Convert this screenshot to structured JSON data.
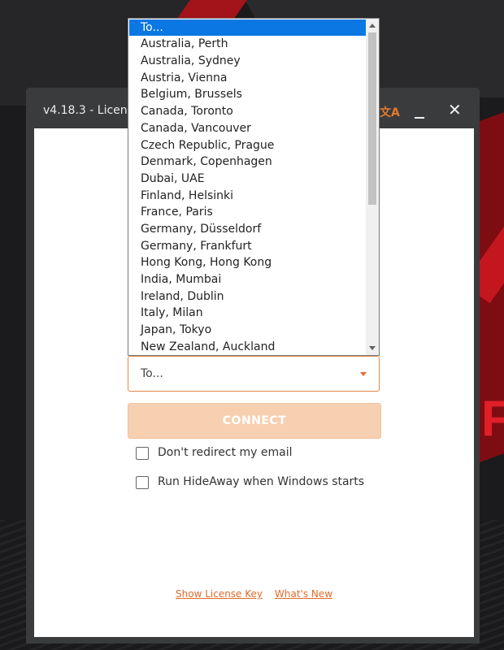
{
  "window": {
    "title": "v4.18.3 - License"
  },
  "title_icons": {
    "language": "translate-icon",
    "minimize": "minimize-icon",
    "close": "✕"
  },
  "destination": {
    "selected": "To...",
    "options": [
      "To...",
      "Australia, Perth",
      "Australia, Sydney",
      "Austria, Vienna",
      "Belgium, Brussels",
      "Canada, Toronto",
      "Canada, Vancouver",
      "Czech Republic, Prague",
      "Denmark, Copenhagen",
      "Dubai, UAE",
      "Finland, Helsinki",
      "France, Paris",
      "Germany, Düsseldorf",
      "Germany, Frankfurt",
      "Hong Kong, Hong Kong",
      "India, Mumbai",
      "Ireland, Dublin",
      "Italy, Milan",
      "Japan, Tokyo",
      "New Zealand, Auckland"
    ]
  },
  "connect_button": "CONNECT",
  "checkboxes": {
    "email": "Don't redirect my email",
    "startup": "Run HideAway when Windows starts"
  },
  "links": {
    "license": "Show License Key",
    "whats_new": "What's New"
  },
  "colors": {
    "accent": "#e36b2a",
    "selection": "#0a77e3"
  }
}
